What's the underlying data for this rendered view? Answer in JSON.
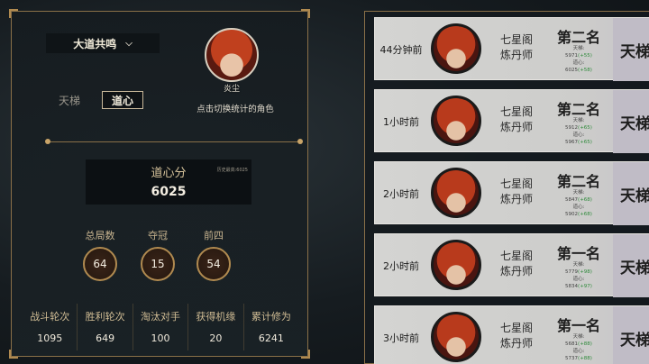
{
  "left": {
    "mode_dropdown": "大道共鸣",
    "tabs": {
      "ladder": "天梯",
      "daoxin": "道心"
    },
    "character_name": "炎尘",
    "switch_hint": "点击切换统计的角色",
    "score": {
      "title": "道心分",
      "history_label": "历史最高:6025",
      "value": "6025"
    },
    "stats": [
      {
        "label": "总局数",
        "value": "64"
      },
      {
        "label": "夺冠",
        "value": "15"
      },
      {
        "label": "前四",
        "value": "54"
      }
    ],
    "bottom_stats": [
      {
        "label": "战斗轮次",
        "value": "1095"
      },
      {
        "label": "胜利轮次",
        "value": "649"
      },
      {
        "label": "淘汰对手",
        "value": "100"
      },
      {
        "label": "获得机缘",
        "value": "20"
      },
      {
        "label": "累计修为",
        "value": "6241"
      }
    ]
  },
  "records": [
    {
      "time": "44分钟前",
      "sect": "七星阁",
      "role": "炼丹师",
      "rank": "第二名",
      "ladder_label": "天梯:",
      "ladder_value": "5971",
      "ladder_delta": "(+55)",
      "daoxin_label": "道心:",
      "daoxin_value": "6025",
      "daoxin_delta": "(+58)",
      "mode": "天梯"
    },
    {
      "time": "1小时前",
      "sect": "七星阁",
      "role": "炼丹师",
      "rank": "第二名",
      "ladder_label": "天梯:",
      "ladder_value": "5912",
      "ladder_delta": "(+65)",
      "daoxin_label": "道心:",
      "daoxin_value": "5967",
      "daoxin_delta": "(+65)",
      "mode": "天梯"
    },
    {
      "time": "2小时前",
      "sect": "七星阁",
      "role": "炼丹师",
      "rank": "第二名",
      "ladder_label": "天梯:",
      "ladder_value": "5847",
      "ladder_delta": "(+68)",
      "daoxin_label": "道心:",
      "daoxin_value": "5902",
      "daoxin_delta": "(+68)",
      "mode": "天梯"
    },
    {
      "time": "2小时前",
      "sect": "七星阁",
      "role": "炼丹师",
      "rank": "第一名",
      "ladder_label": "天梯:",
      "ladder_value": "5779",
      "ladder_delta": "(+98)",
      "daoxin_label": "道心:",
      "daoxin_value": "5834",
      "daoxin_delta": "(+97)",
      "mode": "天梯"
    },
    {
      "time": "3小时前",
      "sect": "七星阁",
      "role": "炼丹师",
      "rank": "第一名",
      "ladder_label": "天梯:",
      "ladder_value": "5681",
      "ladder_delta": "(+88)",
      "daoxin_label": "道心:",
      "daoxin_value": "5737",
      "daoxin_delta": "(+88)",
      "mode": "天梯"
    }
  ]
}
